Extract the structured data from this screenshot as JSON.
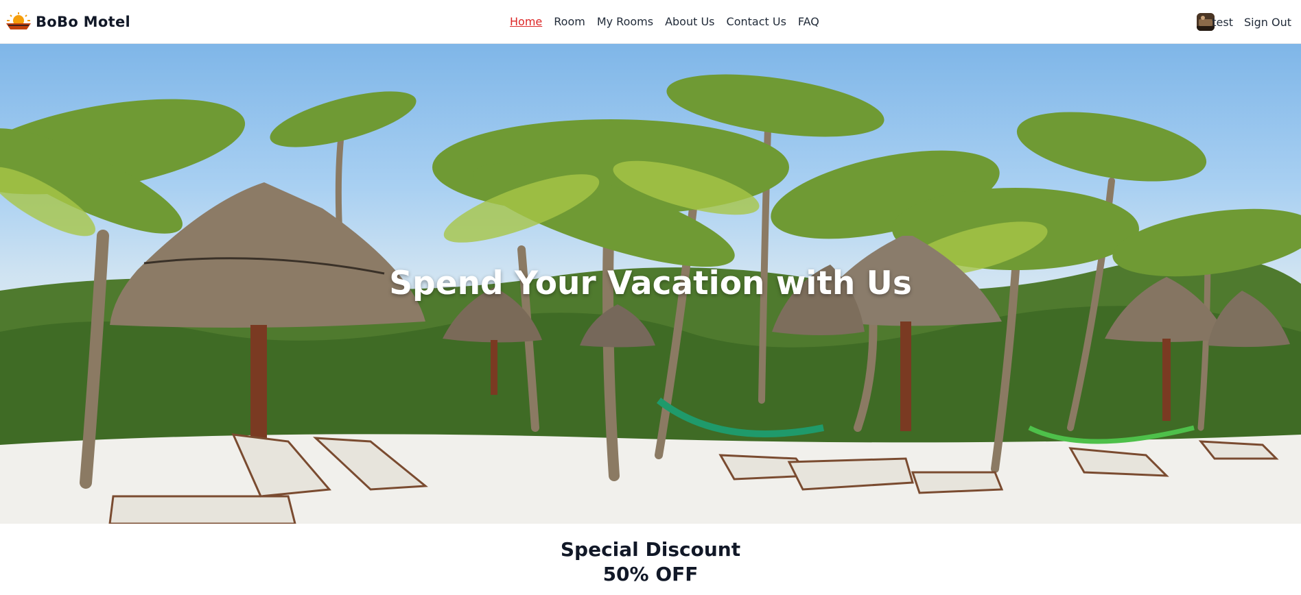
{
  "brand": {
    "name": "BoBo Motel",
    "logo_icon": "sun-boat-logo-icon"
  },
  "nav": {
    "items": [
      {
        "label": "Home",
        "active": true
      },
      {
        "label": "Room",
        "active": false
      },
      {
        "label": "My Rooms",
        "active": false
      },
      {
        "label": "About Us",
        "active": false
      },
      {
        "label": "Contact Us",
        "active": false
      },
      {
        "label": "FAQ",
        "active": false
      }
    ],
    "active_color": "#dc2626"
  },
  "user": {
    "name": "test",
    "avatar_icon": "user-avatar-icon",
    "signout_label": "Sign Out"
  },
  "hero": {
    "title": "Spend Your Vacation with Us"
  },
  "promo": {
    "title": "Special Discount",
    "subtitle": "50% OFF"
  }
}
